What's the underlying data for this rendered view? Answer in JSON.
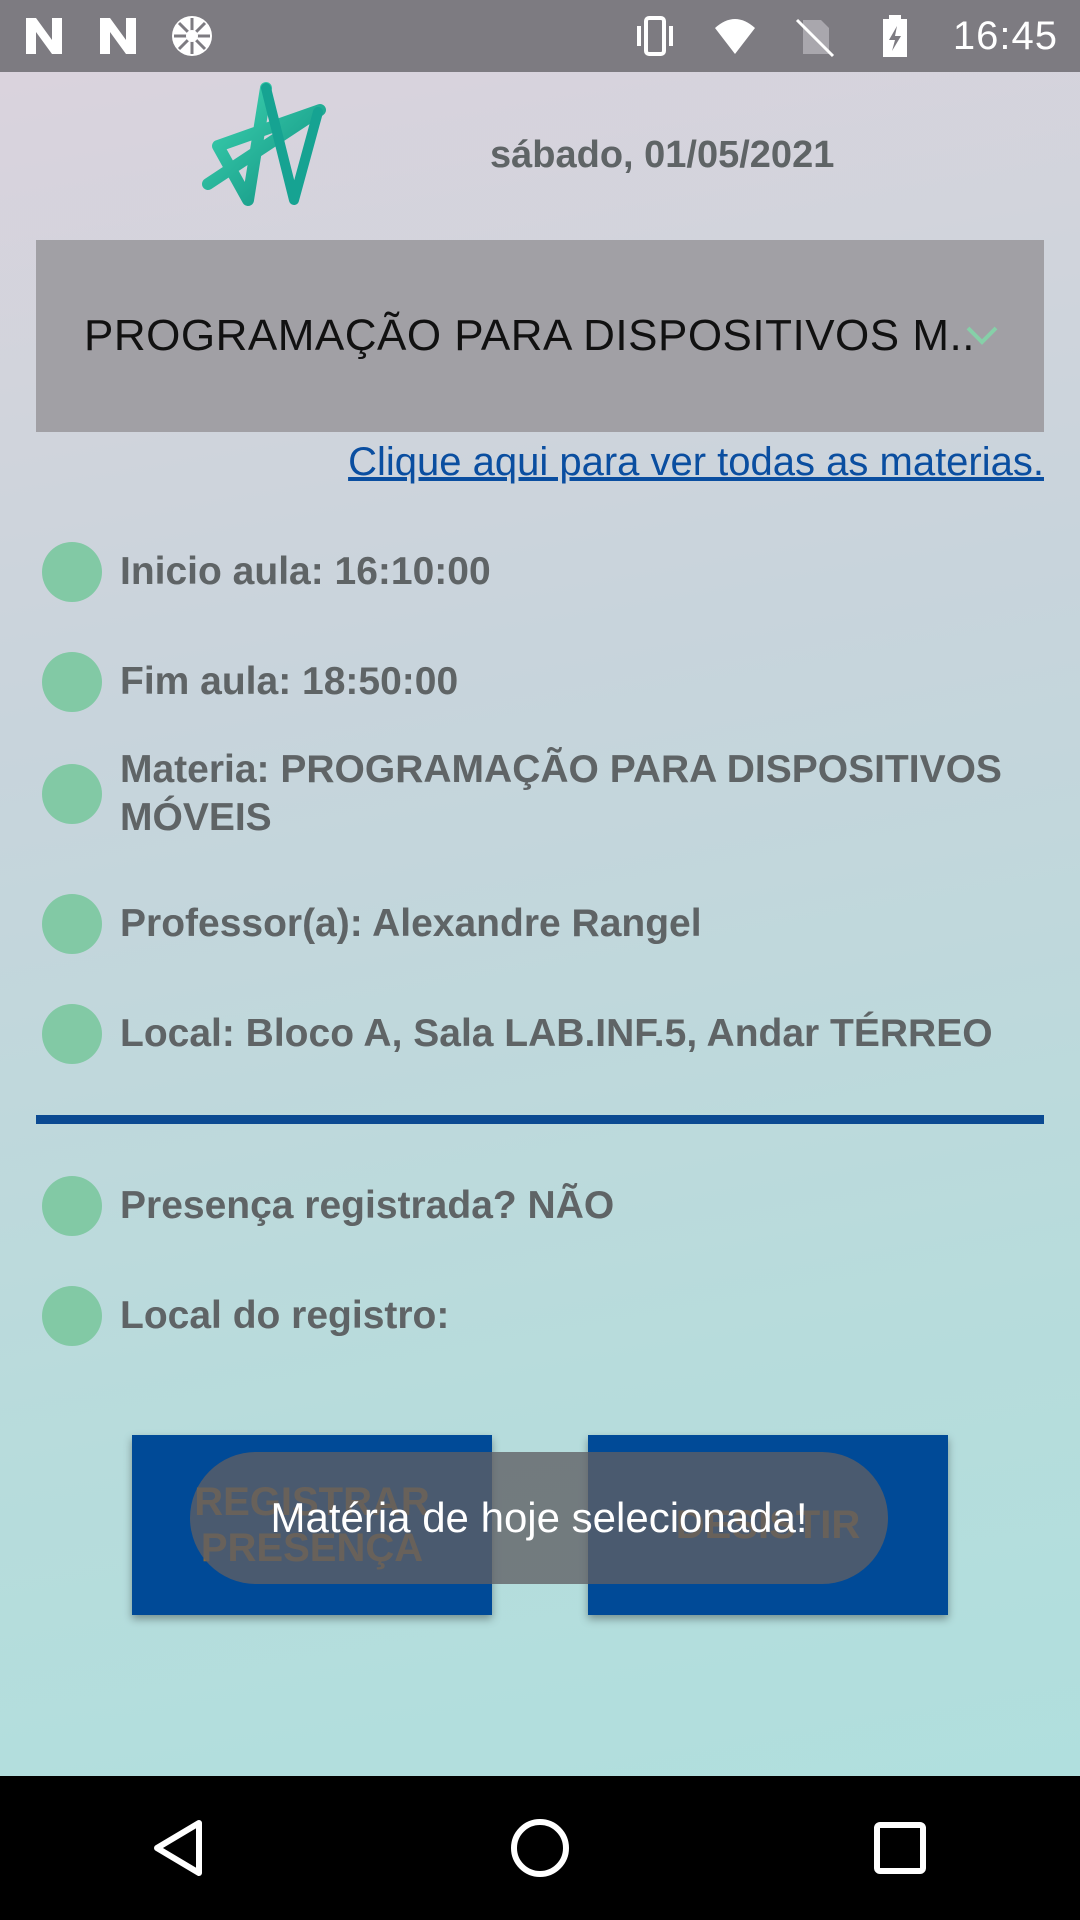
{
  "status_bar": {
    "time": "16:45",
    "left_icons": [
      "n-notification-icon",
      "n-notification-icon",
      "network-hub-icon"
    ],
    "right_icons": [
      "vibrate-icon",
      "wifi-icon",
      "no-sim-icon",
      "battery-charging-icon"
    ]
  },
  "header": {
    "date": "sábado, 01/05/2021"
  },
  "subject_spinner": {
    "selected": "PROGRAMAÇÃO PARA DISPOSITIVOS M.."
  },
  "all_subjects_link": "Clique aqui para ver todas as materias.",
  "class_info": [
    {
      "text": "Inicio aula: 16:10:00"
    },
    {
      "text": "Fim aula: 18:50:00"
    },
    {
      "text": "Materia: PROGRAMAÇÃO PARA DISPOSITIVOS MÓVEIS"
    },
    {
      "text": "Professor(a): Alexandre Rangel"
    },
    {
      "text": "Local: Bloco A, Sala LAB.INF.5, Andar TÉRREO"
    }
  ],
  "attendance_info": [
    {
      "text": "Presença registrada? NÃO"
    },
    {
      "text": "Local do registro:"
    }
  ],
  "buttons": {
    "register": "REGISTRAR PRESENÇA",
    "quit": "DESISTIR"
  },
  "toast": "Matéria de hoje selecionada!",
  "colors": {
    "accent_blue": "#004a97",
    "dot_green": "#82c9a5",
    "spinner_bg": "#a1a0a5",
    "link_blue": "#0a4ea0"
  }
}
